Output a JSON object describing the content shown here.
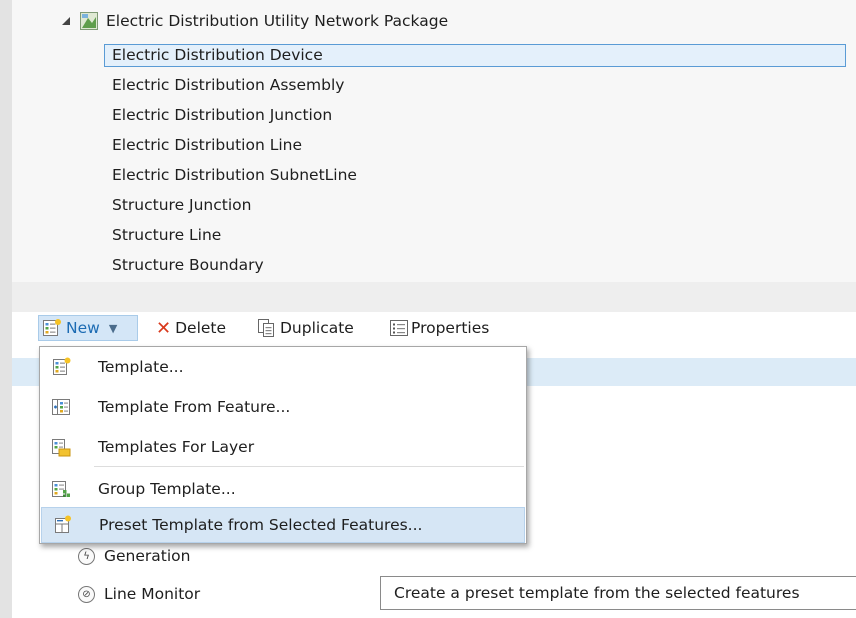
{
  "layer_tree": {
    "package_label": "Electric Distribution Utility Network Package",
    "items": [
      {
        "label": "Electric Distribution Device",
        "selected": true
      },
      {
        "label": "Electric Distribution Assembly"
      },
      {
        "label": "Electric Distribution Junction"
      },
      {
        "label": "Electric Distribution Line"
      },
      {
        "label": "Electric Distribution SubnetLine"
      },
      {
        "label": "Structure Junction"
      },
      {
        "label": "Structure Line"
      },
      {
        "label": "Structure Boundary"
      }
    ]
  },
  "toolbar": {
    "new_label": "New",
    "delete_label": "Delete",
    "duplicate_label": "Duplicate",
    "properties_label": "Properties"
  },
  "new_menu": {
    "items": [
      {
        "label": "Template...",
        "icon": "template-icon"
      },
      {
        "label": "Template From Feature...",
        "icon": "template-from-feature-icon"
      },
      {
        "label": "Templates For Layer",
        "icon": "templates-for-layer-icon"
      },
      {
        "label": "Group Template...",
        "icon": "group-template-icon"
      },
      {
        "label": "Preset Template from Selected Features...",
        "icon": "preset-template-icon",
        "highlighted": true
      }
    ]
  },
  "template_list": {
    "items": [
      {
        "label": "Generation",
        "icon": "generation-icon"
      },
      {
        "label": "Line Monitor",
        "icon": "line-monitor-icon"
      }
    ]
  },
  "tooltip": {
    "text": "Create a preset template from the selected features"
  },
  "colors": {
    "selection_border": "#5a9bd5",
    "selection_fill": "#e4f0fb",
    "menu_highlight": "#d6e6f5",
    "delete_red": "#d9391c",
    "new_text": "#1c6bb3"
  }
}
